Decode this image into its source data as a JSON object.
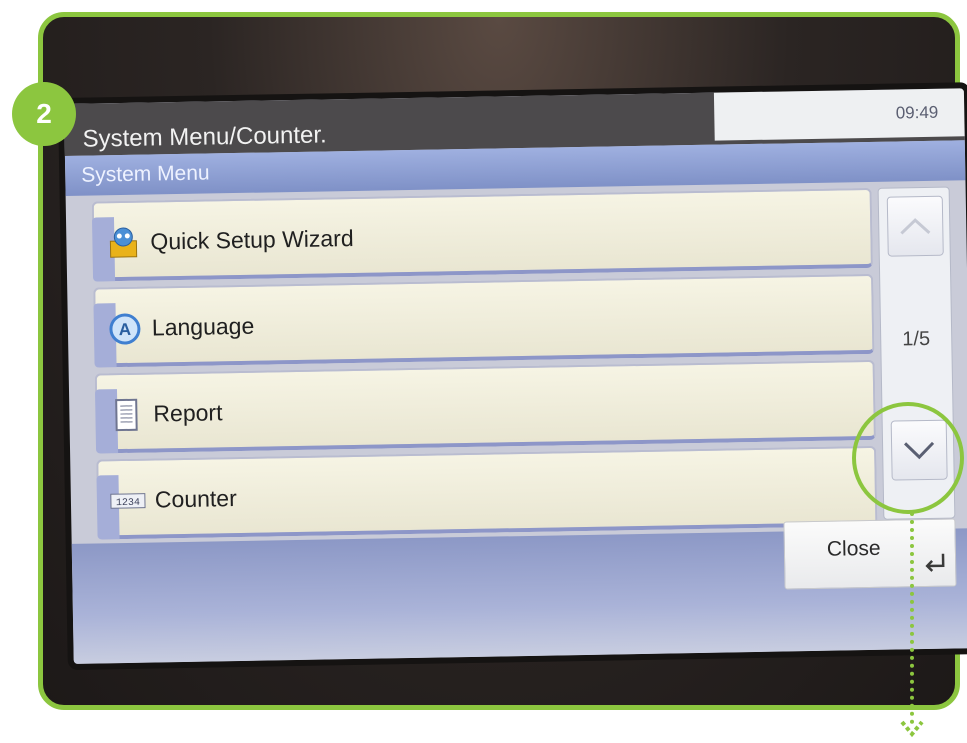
{
  "step": {
    "number": "2"
  },
  "screen": {
    "title": "System Menu/Counter.",
    "clock": "09:49",
    "section_title": "System Menu",
    "items": [
      {
        "label": "Quick Setup Wizard",
        "icon": "wizard-icon"
      },
      {
        "label": "Language",
        "icon": "language-icon"
      },
      {
        "label": "Report",
        "icon": "report-icon"
      },
      {
        "label": "Counter",
        "icon": "counter-icon"
      }
    ],
    "pagination": {
      "current": 1,
      "total": 5,
      "label": "1/5"
    },
    "scroll_up_icon": "chevron-up-icon",
    "scroll_down_icon": "chevron-down-icon",
    "close_label": "Close",
    "close_icon": "enter-icon"
  },
  "colors": {
    "accent_green": "#8cc63f",
    "title_bar": "#4c4a4c",
    "subbar": "#8a9bd0",
    "item_background": "#f3f1df"
  }
}
